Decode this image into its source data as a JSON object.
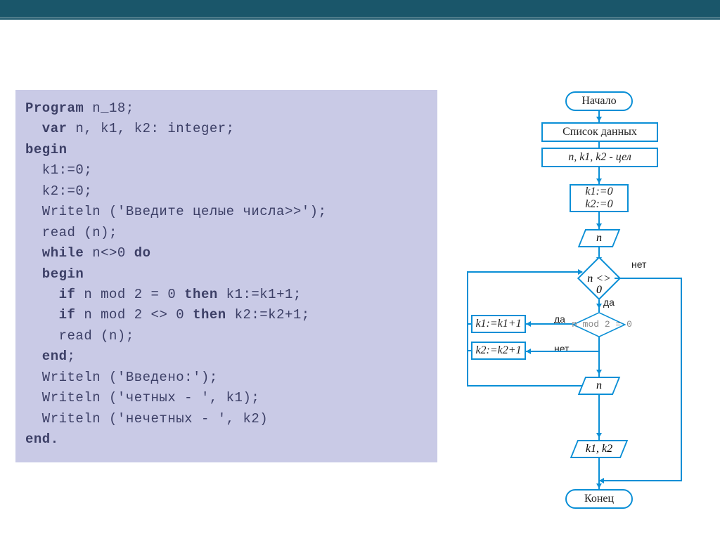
{
  "code": {
    "l1a": "Program",
    "l1b": " n_18;",
    "l2a": "  var",
    "l2b": " n, k1, k2: integer;",
    "l3": "begin",
    "l4": "  k1:=0;",
    "l5": "  k2:=0;",
    "l6": "  Writeln ('Введите целые числа>>');",
    "l7": "  read (n);",
    "l8a": "  while",
    "l8b": " n<>0 ",
    "l8c": "do",
    "l9": "  begin",
    "l10a": "    if",
    "l10b": " n mod 2 = 0 ",
    "l10c": "then",
    "l10d": " k1:=k1+1;",
    "l11a": "    if",
    "l11b": " n mod 2 <> 0 ",
    "l11c": "then",
    "l11d": " k2:=k2+1;",
    "l12": "    read (n);",
    "l13": "  end",
    "l13b": ";",
    "l14": "  Writeln ('Введено:');",
    "l15": "  Writeln ('четных - ', k1);",
    "l16": "  Writeln ('нечетных - ', k2)",
    "l17": "end."
  },
  "flow": {
    "start": "Начало",
    "list": "Список данных",
    "decl": "n, k1, k2 - цел",
    "init1": "k1:=0",
    "init2": "k2:=0",
    "n": "n",
    "cond1": "n <> 0",
    "cond2": "n mod 2 = 0",
    "yes": "да",
    "no": "нет",
    "k1": "k1:=k1+1",
    "k2": "k2:=k2+1",
    "out": "k1, k2",
    "end": "Конец"
  }
}
